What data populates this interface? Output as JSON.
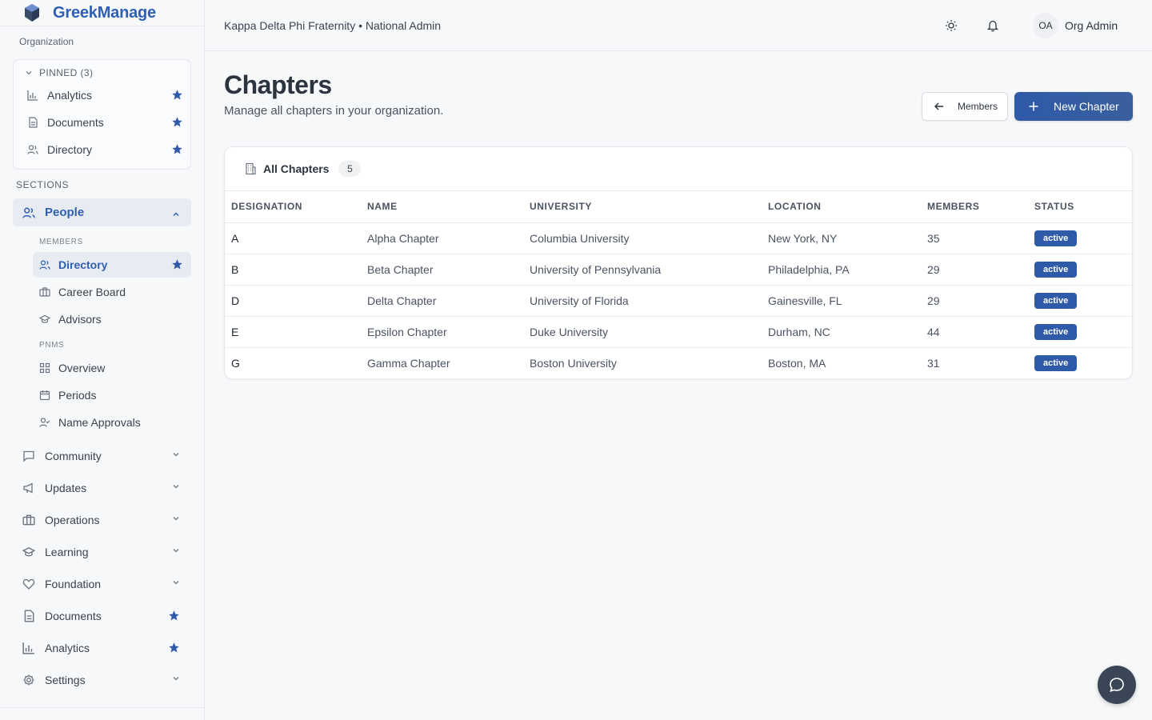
{
  "brand": {
    "name": "GreekManage"
  },
  "sidebar": {
    "org_label": "Organization",
    "pinned": {
      "header": "PINNED (3)",
      "items": [
        {
          "label": "Analytics",
          "icon": "bar-chart-icon"
        },
        {
          "label": "Documents",
          "icon": "document-icon"
        },
        {
          "label": "Directory",
          "icon": "users-icon"
        }
      ]
    },
    "sections_label": "SECTIONS",
    "people": {
      "label": "People",
      "members_label": "MEMBERS",
      "members_items": [
        {
          "label": "Directory",
          "active": true
        },
        {
          "label": "Career Board"
        },
        {
          "label": "Advisors"
        }
      ],
      "pnms_label": "PNMS",
      "pnms_items": [
        {
          "label": "Overview"
        },
        {
          "label": "Periods"
        },
        {
          "label": "Name Approvals"
        }
      ]
    },
    "sections": [
      {
        "label": "Community"
      },
      {
        "label": "Updates"
      },
      {
        "label": "Operations"
      },
      {
        "label": "Learning"
      },
      {
        "label": "Foundation"
      },
      {
        "label": "Documents"
      },
      {
        "label": "Analytics"
      },
      {
        "label": "Settings"
      }
    ]
  },
  "header": {
    "title": "Kappa Delta Phi Fraternity • National Admin",
    "avatar_initials": "OA",
    "user_name": "Org Admin"
  },
  "main": {
    "title": "Chapters",
    "subtitle": "Manage all chapters in your organization.",
    "members_button": "Members",
    "new_button": "New Chapter",
    "card_title": "All Chapters",
    "count": "5",
    "columns": [
      "DESIGNATION",
      "NAME",
      "UNIVERSITY",
      "LOCATION",
      "MEMBERS",
      "STATUS"
    ],
    "rows": [
      {
        "designation": "A",
        "name": "Alpha Chapter",
        "university": "Columbia University",
        "location": "New York, NY",
        "members": "35",
        "status": "active"
      },
      {
        "designation": "B",
        "name": "Beta Chapter",
        "university": "University of Pennsylvania",
        "location": "Philadelphia, PA",
        "members": "29",
        "status": "active"
      },
      {
        "designation": "D",
        "name": "Delta Chapter",
        "university": "University of Florida",
        "location": "Gainesville, FL",
        "members": "29",
        "status": "active"
      },
      {
        "designation": "E",
        "name": "Epsilon Chapter",
        "university": "Duke University",
        "location": "Durham, NC",
        "members": "44",
        "status": "active"
      },
      {
        "designation": "G",
        "name": "Gamma Chapter",
        "university": "Boston University",
        "location": "Boston, MA",
        "members": "31",
        "status": "active"
      }
    ]
  },
  "colors": {
    "accent": "#2f5aa8",
    "brand": "#2f5fb3",
    "star": "#2f5aa8"
  }
}
